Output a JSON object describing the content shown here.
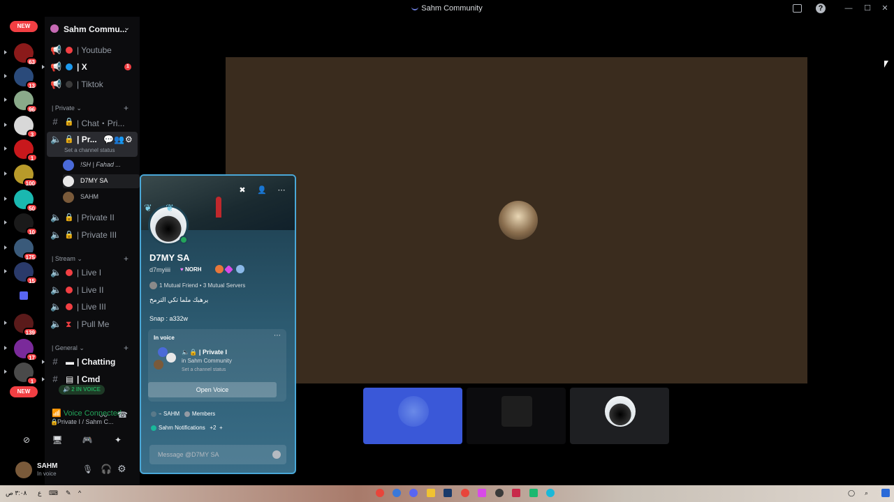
{
  "window": {
    "title": "Sahm Community"
  },
  "servers": {
    "new_top": "NEW",
    "new_bottom": "NEW",
    "badges": [
      "63",
      "13",
      "96",
      "3",
      "1",
      "100",
      "50",
      "10",
      "175",
      "15",
      "139",
      "17",
      "1"
    ]
  },
  "sidebar": {
    "server_name": "Sahm Commu...",
    "channels_top": [
      {
        "label": "| Youtube",
        "dot": "#f23f43"
      },
      {
        "label": "| X",
        "dot": "#1d9bf0",
        "badge": "1"
      },
      {
        "label": "| Tiktok",
        "dot": "#3a3a3a"
      }
    ],
    "cat_private": "| Private",
    "private_channels": {
      "chat": "| Chat・Pri...",
      "active": "| Pr...",
      "active_status": "Set a channel status",
      "private2": "| Private II",
      "private3": "| Private III"
    },
    "voice_users": [
      "!SH | Fahad ...",
      "D7MY SA",
      "SAHM"
    ],
    "cat_stream": "| Stream",
    "stream_channels": [
      "| Live I",
      "| Live II",
      "| Live III",
      "| Pull Me"
    ],
    "cat_general": "| General",
    "general_channels": [
      "| Chatting",
      "| Cmd"
    ],
    "in_voice_pill": "2 IN VOICE"
  },
  "voice_panel": {
    "status": "Voice Connected",
    "channel": "Private I / Sahm C..."
  },
  "user_panel": {
    "name": "SAHM",
    "status": "In voice"
  },
  "profile": {
    "display_name": "D7MY SA",
    "username": "d7myiiii",
    "tag": "NORH",
    "mutual": "1 Mutual Friend • 3 Mutual Servers",
    "bio": "يرهبك ملما تكي الترمخ",
    "snap": "Snap : a332w",
    "invoice_header": "In voice",
    "invoice_channel": "| Private I",
    "invoice_server": "in Sahm Community",
    "invoice_status": "Set a channel status",
    "open_voice": "Open Voice",
    "role_sahm": "SAHM",
    "role_members": "Members",
    "role_notif": "Sahm Notifications",
    "role_more": "+2",
    "message_placeholder": "Message @D7MY SA"
  },
  "taskbar": {
    "lang": "ع",
    "time": "٣:٠٨ ص"
  },
  "colors": {
    "accent": "#4aa8d8",
    "online": "#23a55a",
    "danger": "#f23f43"
  }
}
